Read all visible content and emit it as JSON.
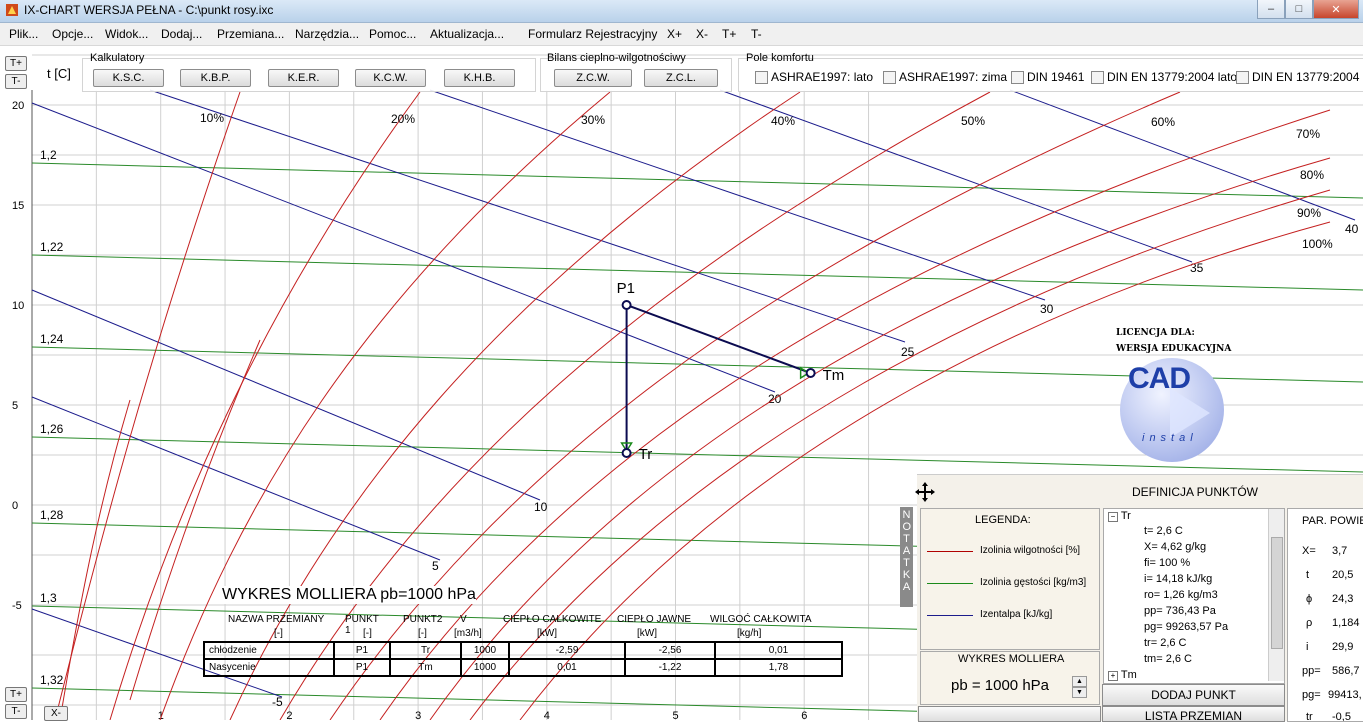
{
  "window": {
    "title": "IX-CHART WERSJA PEŁNA - C:\\punkt rosy.ixc",
    "min": "–",
    "max": "□",
    "close": "✕"
  },
  "menu": [
    "Plik...",
    "Opcje...",
    "Widok...",
    "Dodaj...",
    "Przemiana...",
    "Narzędzia...",
    "Pomoc...",
    "Aktualizacja...",
    "Formularz Rejestracyjny",
    "X+",
    "X-",
    "T+",
    "T-"
  ],
  "toolbar": {
    "kalkulatory_title": "Kalkulatory",
    "kalkulatory": [
      "K.S.C.",
      "K.B.P.",
      "K.E.R.",
      "K.C.W.",
      "K.H.B."
    ],
    "bilans_title": "Bilans cieplno-wilgotnościwy",
    "bilans": [
      "Z.C.W.",
      "Z.C.L."
    ],
    "pole_title": "Pole komfortu",
    "komfort": [
      "ASHRAE1997: lato",
      "ASHRAE1997: zima",
      "DIN 19461",
      "DIN EN 13779:2004 lato",
      "DIN EN 13779:2004 zima"
    ],
    "t_plus": "T+",
    "t_minus": "T-",
    "x_minus": "X-"
  },
  "chart_data": {
    "type": "mollier",
    "ylabel": "t [C]",
    "x_ticks": [
      1,
      2,
      3,
      4,
      5,
      6
    ],
    "y_ticks": [
      20,
      15,
      10,
      5,
      0,
      -5
    ],
    "density_labels": [
      "1,2",
      "1,22",
      "1,24",
      "1,26",
      "1,28",
      "1,3",
      "1,32"
    ],
    "enthalpy_labels": [
      "-5",
      "5",
      "10",
      "20",
      "25",
      "30",
      "35",
      "40"
    ],
    "humidity_labels": [
      "10%",
      "20%",
      "30%",
      "40%",
      "50%",
      "60%",
      "70%",
      "80%",
      "90%",
      "100%"
    ],
    "points": [
      {
        "name": "P1",
        "x": 4.62,
        "t": 10.0
      },
      {
        "name": "Tr",
        "x": 4.62,
        "t": 2.6
      },
      {
        "name": "Tm",
        "x": 6.05,
        "t": 6.6
      }
    ],
    "title": "WYKRES MOLLIERA  pb=1000 hPa"
  },
  "transform_table": {
    "headers": [
      "NAZWA PRZEMIANY",
      "PUNKT 1",
      "PUNKT2",
      "V",
      "CIEPŁO CAŁKOWITE",
      "CIEPŁO JAWNE",
      "WILGOĆ CAŁKOWITA"
    ],
    "units": [
      "[-]",
      "[-]",
      "[-]",
      "[m3/h]",
      "[kW]",
      "[kW]",
      "[kg/h]"
    ],
    "rows": [
      [
        "chłodzenie",
        "P1",
        "Tr",
        "1000",
        "-2,59",
        "-2,56",
        "0,01"
      ],
      [
        "Nasycenie",
        "P1",
        "Tm",
        "1000",
        "0,01",
        "-1,22",
        "1,78"
      ]
    ]
  },
  "license": {
    "line1": "LICENCJA DLA:",
    "line2": "WERSJA EDUKACYJNA",
    "logo": "CAD",
    "logo_sub": "instal"
  },
  "panel": {
    "header": "DEFINICJA PUNKTÓW",
    "notatka": "NOTATKA",
    "legend_title": "LEGENDA:",
    "legend": [
      {
        "label": "Izolinia wilgotności [%]",
        "color": "#b00000"
      },
      {
        "label": "Izolinia gęstości [kg/m3]",
        "color": "#1a8a1a"
      },
      {
        "label": "Izentalpa [kJ/kg]",
        "color": "#1c1c8c"
      }
    ],
    "molliera_title": "WYKRES MOLLIERA",
    "pb": "pb =  1000 hPa",
    "tree_root": "Tr",
    "tree_items": [
      "t= 2,6 C",
      "X= 4,62 g/kg",
      "fi= 100 %",
      "i= 14,18 kJ/kg",
      "ro= 1,26 kg/m3",
      "pp= 736,43 Pa",
      "pg= 99263,57 Pa",
      "tr= 2,6 C",
      "tm= 2,6 C"
    ],
    "tree_next": "Tm",
    "params_title": "PAR. POWIE",
    "params": [
      {
        "k": "X=",
        "v": "3,7"
      },
      {
        "k": "t",
        "v": "20,5"
      },
      {
        "k": "ϕ",
        "v": "24,3"
      },
      {
        "k": "ρ",
        "v": "1,184"
      },
      {
        "k": "i",
        "v": "29,9"
      },
      {
        "k": "pp=",
        "v": "586,7"
      },
      {
        "k": "pg=",
        "v": "99413,"
      },
      {
        "k": "tr",
        "v": "-0,5"
      }
    ],
    "add_point": "DODAJ PUNKT",
    "list": "LISTA PRZEMIAN"
  }
}
